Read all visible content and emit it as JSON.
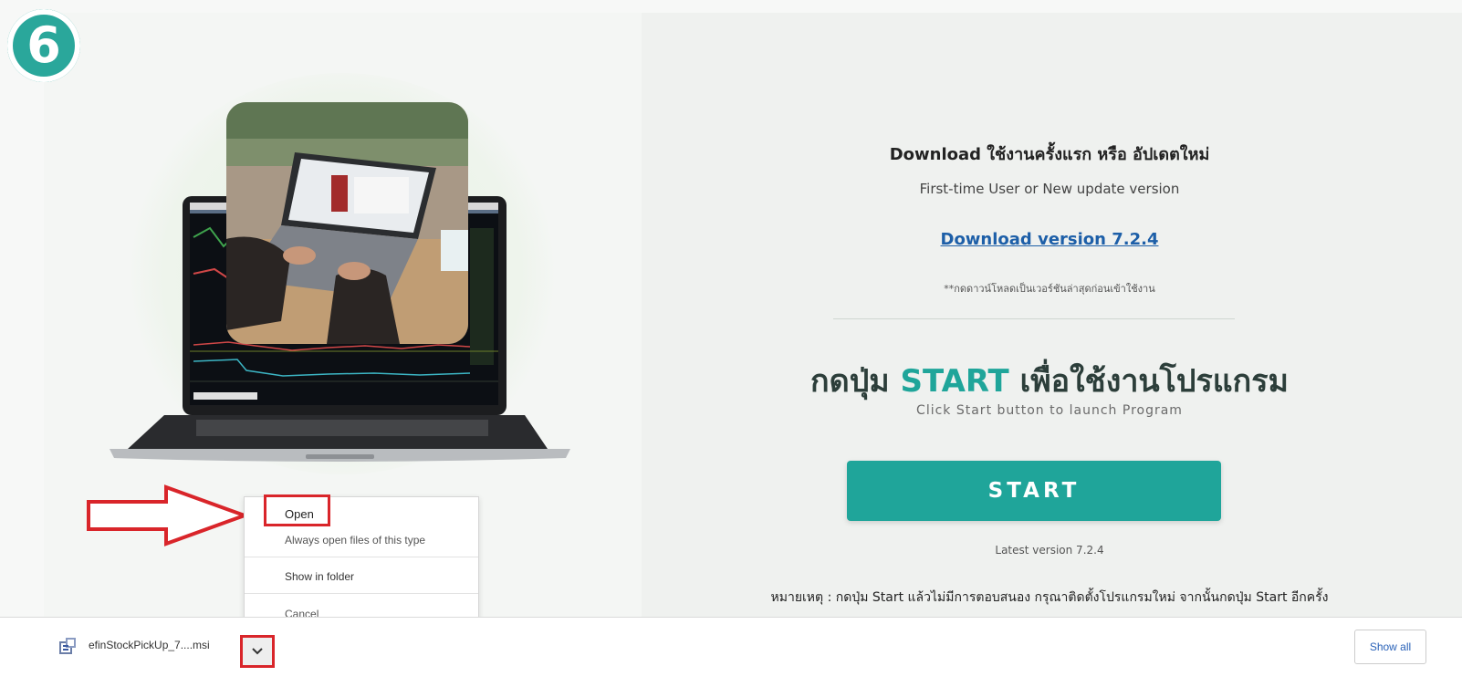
{
  "step_badge": "6",
  "download_section": {
    "title": "Download ใช้งานครั้งแรก หรือ อัปเดตใหม่",
    "subtitle": "First-time User or New update version",
    "link": "Download version 7.2.4",
    "note": "**กดดาวน์โหลดเป็นเวอร์ชันล่าสุดก่อนเข้าใช้งาน"
  },
  "start_section": {
    "heading_before": "กดปุ่ม ",
    "heading_accent": "START",
    "heading_after": " เพื่อใช้งานโปรแกรม",
    "subtitle": "Click Start button to launch Program",
    "button_label": "START",
    "latest_version": "Latest version 7.2.4",
    "remark": "หมายเหตุ : กดปุ่ม Start แล้วไม่มีการตอบสนอง กรุณาติดตั้งโปรแกรมใหม่ จากนั้นกดปุ่ม Start อีกครั้ง"
  },
  "context_menu": {
    "items": [
      "Open",
      "Always open files of this type",
      "Show in folder",
      "Cancel"
    ]
  },
  "download_bar": {
    "file_name": "efinStockPickUp_7....msi",
    "show_all": "Show all"
  },
  "colors": {
    "accent": "#1fa59a",
    "highlight_red": "#d9252a",
    "link_blue": "#1d5fa8"
  }
}
